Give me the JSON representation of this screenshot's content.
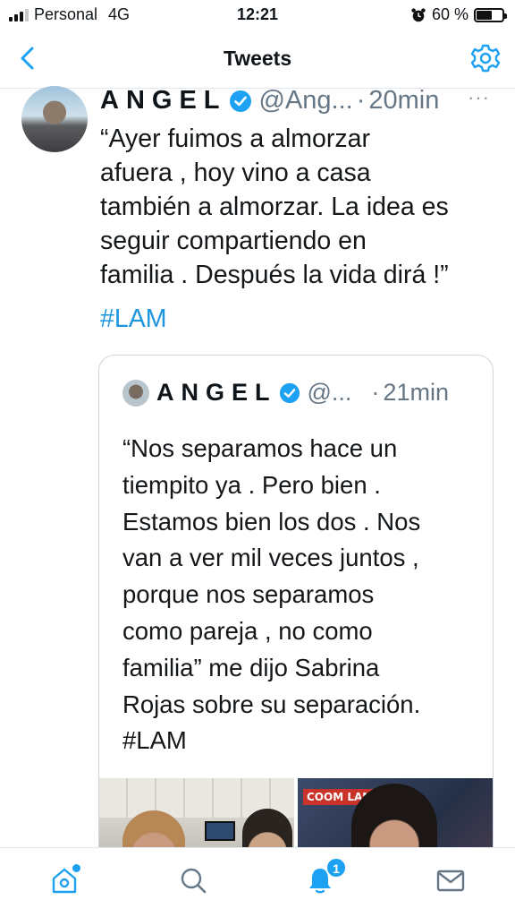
{
  "status_bar": {
    "carrier": "Personal",
    "network": "4G",
    "time": "12:21",
    "battery_percent": "60 %",
    "battery_level": 0.6
  },
  "header": {
    "title": "Tweets",
    "back_icon": "chevron-left-icon",
    "settings_icon": "gear-icon"
  },
  "tweet": {
    "author_name": "ANGEL",
    "handle": "@Ang...",
    "separator": "·",
    "time": "20min",
    "more": "···",
    "text": "“Ayer fuimos a almorzar\nafuera , hoy vino a casa\ntambién a almorzar. La idea es\nseguir compartiendo en\nfamilia . Después la vida dirá !”",
    "hashtag": "#LAM"
  },
  "quoted_tweet": {
    "author_name": "ANGEL",
    "handle": "@...",
    "separator": "·",
    "time": "21min",
    "text": "“Nos separamos hace un\ntiempito ya . Pero bien .\nEstamos bien los dos . Nos\nvan a ver mil veces juntos ,\nporque nos separamos\ncomo pareja , no como\nfamilia” me dijo Sabrina\nRojas sobre su separación.",
    "hashtag": "#LAM",
    "media_logo": "COOM LAM"
  },
  "tab_bar": {
    "items": [
      {
        "icon": "home-icon"
      },
      {
        "icon": "search-icon"
      },
      {
        "icon": "bell-icon",
        "badge": "1"
      },
      {
        "icon": "mail-icon"
      }
    ]
  },
  "colors": {
    "accent": "#1da1f2",
    "text": "#14171a",
    "muted": "#657786",
    "border": "#ccd6dd"
  }
}
